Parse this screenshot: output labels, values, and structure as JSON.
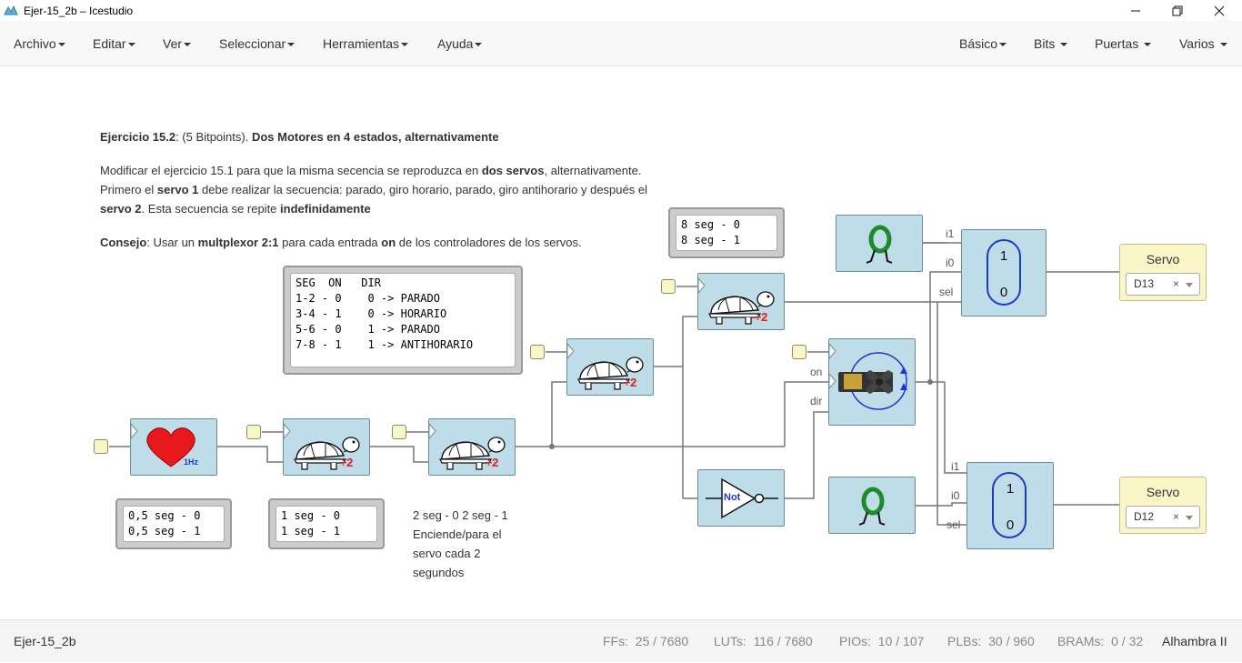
{
  "window": {
    "title": "Ejer-15_2b – Icestudio",
    "minimize_icon": "minimize-icon",
    "maximize_icon": "restore-icon",
    "close_icon": "close-icon"
  },
  "menubar": {
    "left": [
      "Archivo",
      "Editar",
      "Ver",
      "Seleccionar",
      "Herramientas",
      "Ayuda"
    ],
    "right": [
      "Básico",
      "Bits",
      "Puertas",
      "Varios"
    ]
  },
  "description": {
    "heading_label": "Ejercicio 15.2",
    "heading_mid": ": (5 Bitpoints). ",
    "heading_bold": "Dos Motores en 4 estados, alternativamente",
    "p1_a": "Modificar el ejercicio 15.1 para que la misma secencia se reproduzca en ",
    "p1_b": "dos servos",
    "p1_c": ", alternativamente.",
    "p2_a": "Primero el ",
    "p2_b": "servo 1",
    "p2_c": " debe realizar la secuencia: parado, giro horario, parado, giro antihorario y después el",
    "p3_a": "servo 2",
    "p3_b": ". Esta secuencia se repite ",
    "p3_c": "indefinidamente",
    "p4_a": "Consejo",
    "p4_b": ": Usar un ",
    "p4_c": "multplexor 2:1",
    "p4_d": " para cada entrada ",
    "p4_e": "on",
    "p4_f": " de los controladores de los servos."
  },
  "memos": {
    "table": "SEG  ON   DIR\n1-2 - 0    0 -> PARADO\n3-4 - 1    0 -> HORARIO\n5-6 - 0    1 -> PARADO\n7-8 - 1    1 -> ANTIHORARIO",
    "half_sec": "0,5 seg - 0\n0,5 seg - 1",
    "one_sec": "1 seg - 0\n1 seg - 1",
    "eight_sec": "8 seg - 0\n8 seg - 1"
  },
  "note": {
    "line1": "2 seg - 0 2 seg - 1",
    "line2": "Enciende/para el",
    "line3": "servo cada 2",
    "line4": "segundos"
  },
  "blocks": {
    "heart_freq": "1Hz",
    "divider_label": "÷2",
    "not_label": "Not",
    "mux_top": "1",
    "mux_bottom": "0",
    "servo_label": "Servo",
    "pin_on": "on",
    "pin_dir": "dir",
    "pin_i1": "i1",
    "pin_i0": "i0",
    "pin_sel": "sel"
  },
  "servos": [
    {
      "label": "Servo",
      "pin": "D13"
    },
    {
      "label": "Servo",
      "pin": "D12"
    }
  ],
  "statusbar": {
    "project": "Ejer-15_2b",
    "ffs_label": "FFs:",
    "ffs": "25 / 7680",
    "luts_label": "LUTs:",
    "luts": "116 / 7680",
    "pios_label": "PIOs:",
    "pios": "10 / 107",
    "plbs_label": "PLBs:",
    "plbs": "30 / 960",
    "brams_label": "BRAMs:",
    "brams": "0 / 32",
    "board": "Alhambra II"
  },
  "colors": {
    "block_bg": "#bfdde9",
    "input_port": "#fbf6c8",
    "wire": "#777777",
    "mux_oval": "#2038c8",
    "heart": "#e8191c"
  }
}
